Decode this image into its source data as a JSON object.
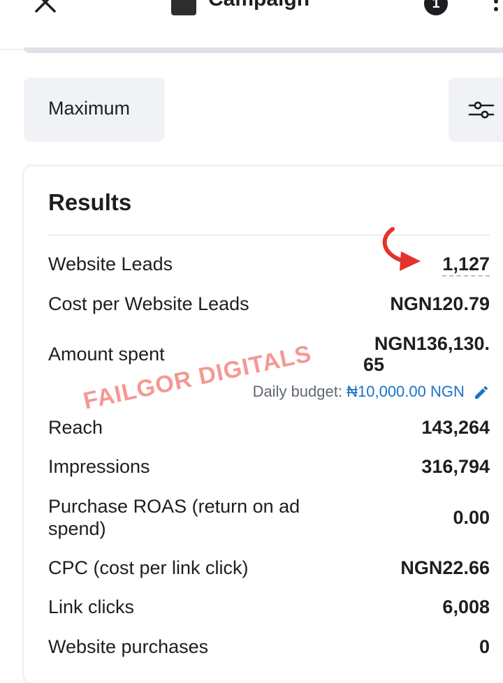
{
  "header": {
    "title": "Campaign",
    "notification_count": "1"
  },
  "filters": {
    "maximum_label": "Maximum"
  },
  "results": {
    "heading": "Results",
    "rows": [
      {
        "label": "Website Leads",
        "value": "1,127"
      },
      {
        "label": "Cost per Website Leads",
        "value": "NGN120.79"
      },
      {
        "label": "Amount spent",
        "value_line1": "NGN136,130.",
        "value_line2": "65"
      },
      {
        "label": "Reach",
        "value": "143,264"
      },
      {
        "label": "Impressions",
        "value": "316,794"
      },
      {
        "label_line1": "Purchase ROAS (return on ad",
        "label_line2": "spend)",
        "value": "0.00"
      },
      {
        "label": "CPC (cost per link click)",
        "value": "NGN22.66"
      },
      {
        "label": "Link clicks",
        "value": "6,008"
      },
      {
        "label": "Website purchases",
        "value": "0"
      }
    ],
    "daily_budget": {
      "label": "Daily budget:",
      "amount": "₦10,000.00 NGN"
    }
  },
  "watermark": "FAILGOR DIGITALS",
  "colors": {
    "accent_blue": "#1a73c8",
    "annotation_red": "#e5322d",
    "pill_bg": "#f0f2f5"
  }
}
